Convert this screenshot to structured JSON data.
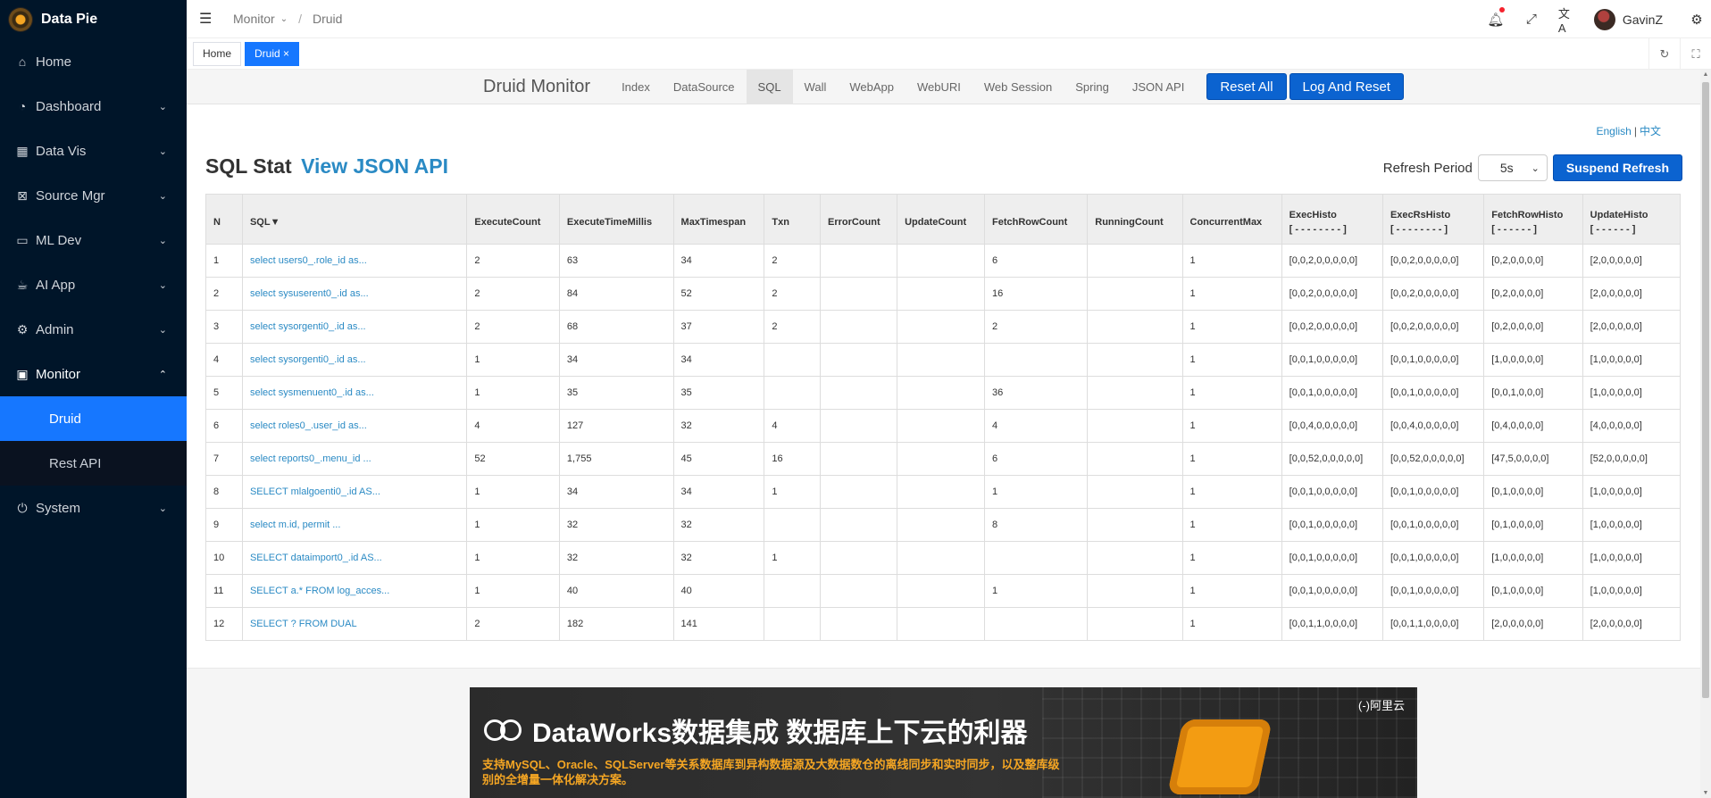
{
  "app": {
    "name": "Data Pie"
  },
  "sidebar": {
    "items": [
      {
        "label": "Home",
        "icon": "home-icon",
        "glyph": "⌂",
        "chevron": ""
      },
      {
        "label": "Dashboard",
        "icon": "dashboard-icon",
        "glyph": "◔",
        "chevron": "⌄"
      },
      {
        "label": "Data Vis",
        "icon": "grid-icon",
        "glyph": "▦",
        "chevron": "⌄"
      },
      {
        "label": "Source Mgr",
        "icon": "source-icon",
        "glyph": "⊠",
        "chevron": "⌄"
      },
      {
        "label": "ML Dev",
        "icon": "laptop-icon",
        "glyph": "▭",
        "chevron": "⌄"
      },
      {
        "label": "AI App",
        "icon": "cup-icon",
        "glyph": "☕",
        "chevron": "⌄"
      },
      {
        "label": "Admin",
        "icon": "gear-icon",
        "glyph": "⚙",
        "chevron": "⌄"
      },
      {
        "label": "Monitor",
        "icon": "monitor-icon",
        "glyph": "▣",
        "chevron": "⌃"
      }
    ],
    "sub_items": [
      {
        "label": "Druid"
      },
      {
        "label": "Rest API"
      }
    ],
    "last_item": {
      "label": "System",
      "icon": "power-icon",
      "glyph": "⏻",
      "chevron": "⌄"
    }
  },
  "header": {
    "breadcrumb": [
      "Monitor",
      "Druid"
    ],
    "user_name": "GavinZ"
  },
  "tabs": [
    {
      "label": "Home"
    },
    {
      "label": "Druid ×"
    }
  ],
  "druid": {
    "brand": "Druid Monitor",
    "nav": [
      "Index",
      "DataSource",
      "SQL",
      "Wall",
      "WebApp",
      "WebURI",
      "Web Session",
      "Spring",
      "JSON API"
    ],
    "buttons": {
      "reset_all": "Reset All",
      "log_and_reset": "Log And Reset"
    },
    "lang": {
      "en": "English",
      "sep": "|",
      "zh": "中文"
    },
    "title": "SQL Stat",
    "title_link": "View JSON API",
    "refresh": {
      "label": "Refresh Period",
      "value": "5s",
      "suspend": "Suspend Refresh"
    }
  },
  "table": {
    "headers": [
      "N",
      "SQL▼",
      "ExecuteCount",
      "ExecuteTimeMillis",
      "MaxTimespan",
      "Txn",
      "ErrorCount",
      "UpdateCount",
      "FetchRowCount",
      "RunningCount",
      "ConcurrentMax",
      "ExecHisto",
      "ExecRsHisto",
      "FetchRowHisto",
      "UpdateHisto"
    ],
    "histo_sub": [
      "[ - - - - - - - - ]",
      "[ - - - - - - - - ]",
      "[ - - - - - - ]",
      "[ - - - - - - ]"
    ],
    "rows": [
      [
        "1",
        "select users0_.role_id as...",
        "2",
        "63",
        "34",
        "2",
        "",
        "",
        "6",
        "",
        "1",
        "[0,0,2,0,0,0,0,0]",
        "[0,0,2,0,0,0,0,0]",
        "[0,2,0,0,0,0]",
        "[2,0,0,0,0,0]"
      ],
      [
        "2",
        "select sysuserent0_.id as...",
        "2",
        "84",
        "52",
        "2",
        "",
        "",
        "16",
        "",
        "1",
        "[0,0,2,0,0,0,0,0]",
        "[0,0,2,0,0,0,0,0]",
        "[0,2,0,0,0,0]",
        "[2,0,0,0,0,0]"
      ],
      [
        "3",
        "select sysorgenti0_.id as...",
        "2",
        "68",
        "37",
        "2",
        "",
        "",
        "2",
        "",
        "1",
        "[0,0,2,0,0,0,0,0]",
        "[0,0,2,0,0,0,0,0]",
        "[0,2,0,0,0,0]",
        "[2,0,0,0,0,0]"
      ],
      [
        "4",
        "select sysorgenti0_.id as...",
        "1",
        "34",
        "34",
        "",
        "",
        "",
        "",
        "",
        "1",
        "[0,0,1,0,0,0,0,0]",
        "[0,0,1,0,0,0,0,0]",
        "[1,0,0,0,0,0]",
        "[1,0,0,0,0,0]"
      ],
      [
        "5",
        "select sysmenuent0_.id as...",
        "1",
        "35",
        "35",
        "",
        "",
        "",
        "36",
        "",
        "1",
        "[0,0,1,0,0,0,0,0]",
        "[0,0,1,0,0,0,0,0]",
        "[0,0,1,0,0,0]",
        "[1,0,0,0,0,0]"
      ],
      [
        "6",
        "select roles0_.user_id as...",
        "4",
        "127",
        "32",
        "4",
        "",
        "",
        "4",
        "",
        "1",
        "[0,0,4,0,0,0,0,0]",
        "[0,0,4,0,0,0,0,0]",
        "[0,4,0,0,0,0]",
        "[4,0,0,0,0,0]"
      ],
      [
        "7",
        "select reports0_.menu_id ...",
        "52",
        "1,755",
        "45",
        "16",
        "",
        "",
        "6",
        "",
        "1",
        "[0,0,52,0,0,0,0,0]",
        "[0,0,52,0,0,0,0,0]",
        "[47,5,0,0,0,0]",
        "[52,0,0,0,0,0]"
      ],
      [
        "8",
        "SELECT mlalgoenti0_.id AS...",
        "1",
        "34",
        "34",
        "1",
        "",
        "",
        "1",
        "",
        "1",
        "[0,0,1,0,0,0,0,0]",
        "[0,0,1,0,0,0,0,0]",
        "[0,1,0,0,0,0]",
        "[1,0,0,0,0,0]"
      ],
      [
        "9",
        "select m.id, permit ...",
        "1",
        "32",
        "32",
        "",
        "",
        "",
        "8",
        "",
        "1",
        "[0,0,1,0,0,0,0,0]",
        "[0,0,1,0,0,0,0,0]",
        "[0,1,0,0,0,0]",
        "[1,0,0,0,0,0]"
      ],
      [
        "10",
        "SELECT dataimport0_.id AS...",
        "1",
        "32",
        "32",
        "1",
        "",
        "",
        "",
        "",
        "1",
        "[0,0,1,0,0,0,0,0]",
        "[0,0,1,0,0,0,0,0]",
        "[1,0,0,0,0,0]",
        "[1,0,0,0,0,0]"
      ],
      [
        "11",
        "SELECT a.* FROM log_acces...",
        "1",
        "40",
        "40",
        "",
        "",
        "",
        "1",
        "",
        "1",
        "[0,0,1,0,0,0,0,0]",
        "[0,0,1,0,0,0,0,0]",
        "[0,1,0,0,0,0]",
        "[1,0,0,0,0,0]"
      ],
      [
        "12",
        "SELECT ? FROM DUAL",
        "2",
        "182",
        "141",
        "",
        "",
        "",
        "",
        "",
        "1",
        "[0,0,1,1,0,0,0,0]",
        "[0,0,1,1,0,0,0,0]",
        "[2,0,0,0,0,0]",
        "[2,0,0,0,0,0]"
      ]
    ]
  },
  "banner": {
    "headline": "DataWorks数据集成 数据库上下云的利器",
    "sub": "支持MySQL、Oracle、SQLServer等关系数据库到异构数据源及大数据数仓的离线同步和实时同步，以及整库级别的全增量一体化解决方案。",
    "brand": "(-)阿里云"
  }
}
